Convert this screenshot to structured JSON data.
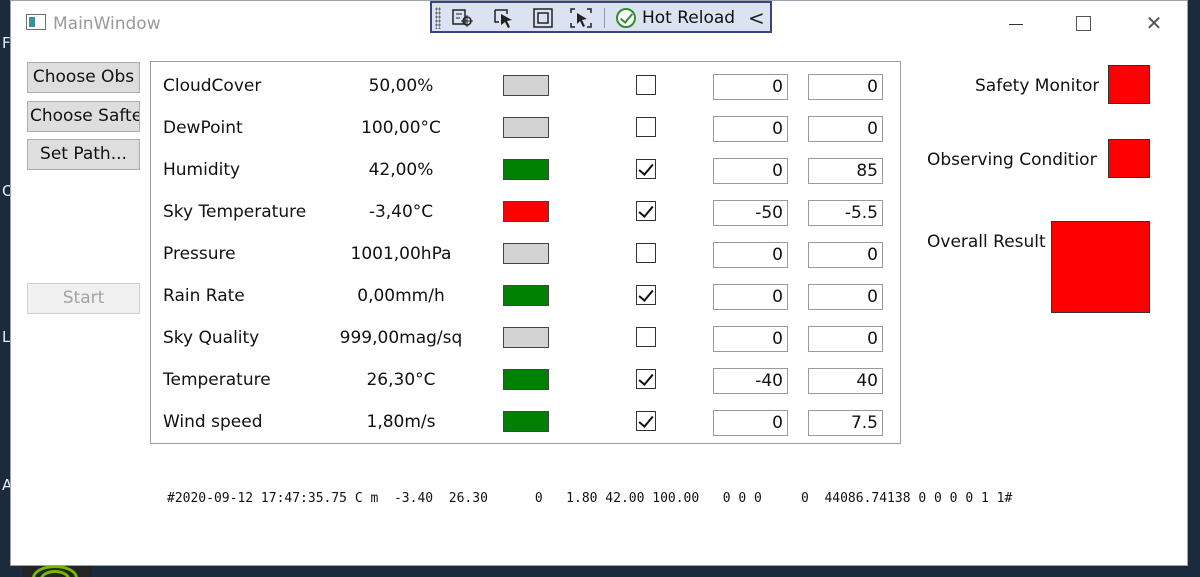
{
  "window": {
    "title": "MainWindow"
  },
  "hot_reload": {
    "label": "Hot Reload"
  },
  "buttons": {
    "choose_obs": "Choose Obs",
    "choose_safety": "Choose Saftey",
    "set_path": "Set Path...",
    "start": "Start"
  },
  "colors": {
    "green": "#008000",
    "red": "#ff0000",
    "gray": "#d3d3d3"
  },
  "sensors": [
    {
      "name": "CloudCover",
      "value": "50,00%",
      "status": "gray",
      "enabled": false,
      "min": "0",
      "max": "0"
    },
    {
      "name": "DewPoint",
      "value": "100,00°C",
      "status": "gray",
      "enabled": false,
      "min": "0",
      "max": "0"
    },
    {
      "name": "Humidity",
      "value": "42,00%",
      "status": "green",
      "enabled": true,
      "min": "0",
      "max": "85"
    },
    {
      "name": "Sky Temperature",
      "value": "-3,40°C",
      "status": "red",
      "enabled": true,
      "min": "-50",
      "max": "-5.5"
    },
    {
      "name": "Pressure",
      "value": "1001,00hPa",
      "status": "gray",
      "enabled": false,
      "min": "0",
      "max": "0"
    },
    {
      "name": "Rain Rate",
      "value": "0,00mm/h",
      "status": "green",
      "enabled": true,
      "min": "0",
      "max": "0"
    },
    {
      "name": "Sky Quality",
      "value": "999,00mag/sq",
      "status": "gray",
      "enabled": false,
      "min": "0",
      "max": "0"
    },
    {
      "name": "Temperature",
      "value": "26,30°C",
      "status": "green",
      "enabled": true,
      "min": "-40",
      "max": "40"
    },
    {
      "name": "Wind speed",
      "value": "1,80m/s",
      "status": "green",
      "enabled": true,
      "min": "0",
      "max": "7.5"
    }
  ],
  "monitors": {
    "safety_monitor": {
      "label": "Safety Monitor",
      "status": "red"
    },
    "observing_conditions": {
      "label": "Observing Conditions",
      "status": "red"
    },
    "overall_result": {
      "label": "Overall Result",
      "status": "red"
    }
  },
  "status_line": "#2020-09-12 17:47:35.75 C m  -3.40  26.30      0   1.80 42.00 100.00   0 0 0     0  44086.74138 0 0 0 0 1 1#",
  "desktop": {
    "letters": [
      "F",
      "Or",
      "Lo",
      "A"
    ]
  }
}
